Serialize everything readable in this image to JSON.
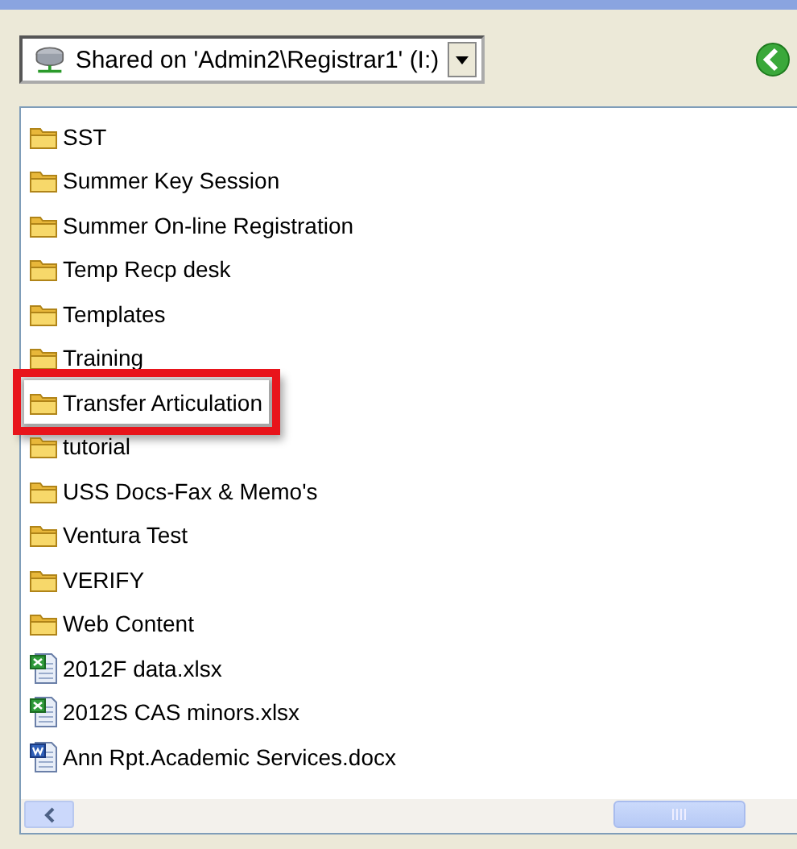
{
  "address_bar": {
    "location": "Shared on 'Admin2\\Registrar1' (I:)"
  },
  "items": [
    {
      "name": "SST",
      "kind": "folder",
      "highlighted": false
    },
    {
      "name": "Summer Key Session",
      "kind": "folder",
      "highlighted": false
    },
    {
      "name": "Summer On-line Registration",
      "kind": "folder",
      "highlighted": false
    },
    {
      "name": "Temp Recp desk",
      "kind": "folder",
      "highlighted": false
    },
    {
      "name": "Templates",
      "kind": "folder",
      "highlighted": false
    },
    {
      "name": "Training",
      "kind": "folder",
      "highlighted": false
    },
    {
      "name": "Transfer Articulation",
      "kind": "folder",
      "highlighted": true
    },
    {
      "name": "tutorial",
      "kind": "folder",
      "highlighted": false
    },
    {
      "name": "USS Docs-Fax & Memo's",
      "kind": "folder",
      "highlighted": false
    },
    {
      "name": "Ventura Test",
      "kind": "folder",
      "highlighted": false
    },
    {
      "name": "VERIFY",
      "kind": "folder",
      "highlighted": false
    },
    {
      "name": "Web Content",
      "kind": "folder",
      "highlighted": false
    },
    {
      "name": "2012F data.xlsx",
      "kind": "excel",
      "highlighted": false
    },
    {
      "name": "2012S CAS minors.xlsx",
      "kind": "excel",
      "highlighted": false
    },
    {
      "name": "Ann Rpt.Academic Services.docx",
      "kind": "word",
      "highlighted": false
    }
  ]
}
